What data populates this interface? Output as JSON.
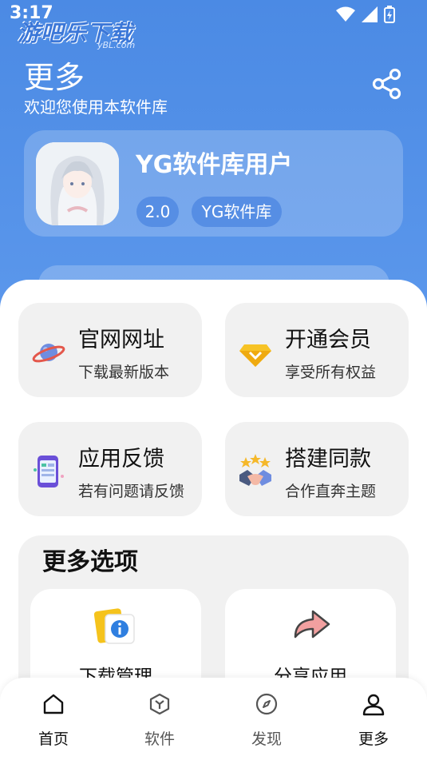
{
  "status_bar": {
    "time": "3:17",
    "watermark": "游吧乐下载",
    "watermark_sub": "yBL.com"
  },
  "header": {
    "title": "更多",
    "subtitle": "欢迎您使用本软件库"
  },
  "profile": {
    "name": "YG软件库用户",
    "version": "2.0",
    "tag": "YG软件库"
  },
  "tiles": [
    {
      "title": "官网网址",
      "subtitle": "下载最新版本",
      "icon": "planet-icon"
    },
    {
      "title": "开通会员",
      "subtitle": "享受所有权益",
      "icon": "diamond-icon"
    },
    {
      "title": "应用反馈",
      "subtitle": "若有问题请反馈",
      "icon": "phone-feedback-icon"
    },
    {
      "title": "搭建同款",
      "subtitle": "合作直奔主题",
      "icon": "handshake-icon"
    }
  ],
  "more_options": {
    "title": "更多选项",
    "items": [
      {
        "label": "下载管理",
        "icon": "info-folder-icon"
      },
      {
        "label": "分享应用",
        "icon": "share-arrow-icon"
      }
    ]
  },
  "nav": [
    {
      "label": "首页",
      "icon": "home-icon",
      "active": true
    },
    {
      "label": "软件",
      "icon": "cube-icon",
      "active": false
    },
    {
      "label": "发现",
      "icon": "compass-icon",
      "active": false
    },
    {
      "label": "更多",
      "icon": "user-icon",
      "active": true
    }
  ],
  "colors": {
    "accent": "#4b8ae4",
    "tile_bg": "#f1f1f1",
    "nav_active": "#111111",
    "nav_inactive": "#666666"
  }
}
